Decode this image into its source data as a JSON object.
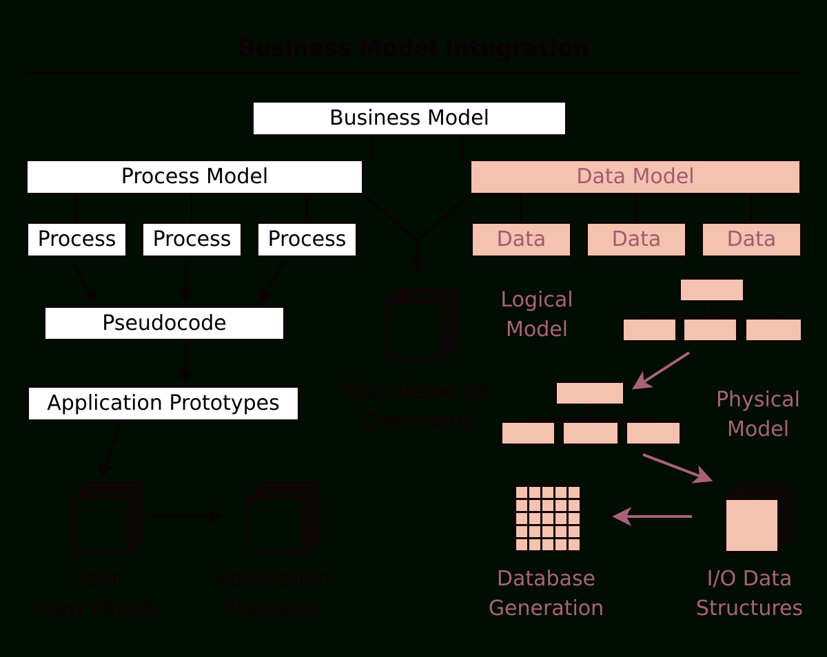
{
  "title": "Business Model Integration",
  "colors": {
    "background": "#010d01",
    "salmon_fill": "#f4c3b0",
    "mauve_text": "#a8637a",
    "dark_text": "#140008",
    "white_fill": "#ffffff",
    "outline": "#140007"
  },
  "top": {
    "business_model": "Business Model"
  },
  "left_branch": {
    "process_model": "Process Model",
    "processes": [
      "Process",
      "Process",
      "Process"
    ],
    "pseudocode": "Pseudocode",
    "application_prototypes": "Application Prototypes",
    "user_view_panels": "User\nView Panels",
    "application_programs": "Application\nPrograms"
  },
  "center_branch": {
    "requirements_document": "Requirements\nDocument"
  },
  "right_branch": {
    "data_model": "Data Model",
    "data_items": [
      "Data",
      "Data",
      "Data"
    ],
    "logical_model": "Logical\nModel",
    "physical_model": "Physical\nModel",
    "database_generation": "Database\nGeneration",
    "io_data_structures": "I/O Data\nStructures"
  },
  "diagram_meta": {
    "type": "flow-diagram",
    "grid_rows": 5,
    "grid_cols": 5,
    "stack_sheets": 4
  }
}
